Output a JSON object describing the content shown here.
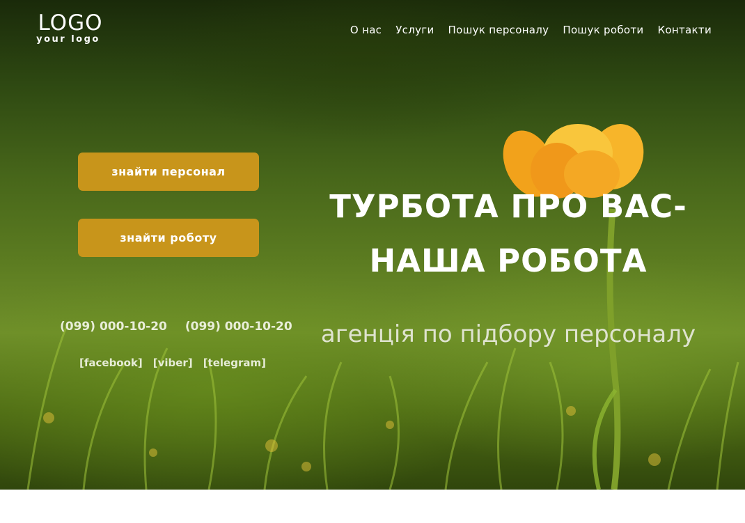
{
  "logo": {
    "main": "LOGO",
    "sub": "your logo"
  },
  "nav": {
    "items": [
      {
        "label": "О нас"
      },
      {
        "label": "Услуги"
      },
      {
        "label": "Пошук персоналу"
      },
      {
        "label": "Пошук роботи"
      },
      {
        "label": "Контакти"
      }
    ]
  },
  "buttons": {
    "find_staff": "знайти персонал",
    "find_job": "знайти роботу"
  },
  "contacts": {
    "phone_1": "(099) 000-10-20",
    "phone_2": "(099) 000-10-20",
    "facebook": "[facebook]",
    "viber": "[viber]",
    "telegram": "[telegram]"
  },
  "hero": {
    "headline_line_1": "ТУРБОТА ПРО ВАС-",
    "headline_line_2": "НАША РОБОТА",
    "subtitle": "агенція по підбору персоналу",
    "image_subject": "orange tulip in green grass"
  },
  "colors": {
    "button": "#c8951b",
    "text": "#ffffff",
    "subtitle": "#dfe3cf"
  }
}
